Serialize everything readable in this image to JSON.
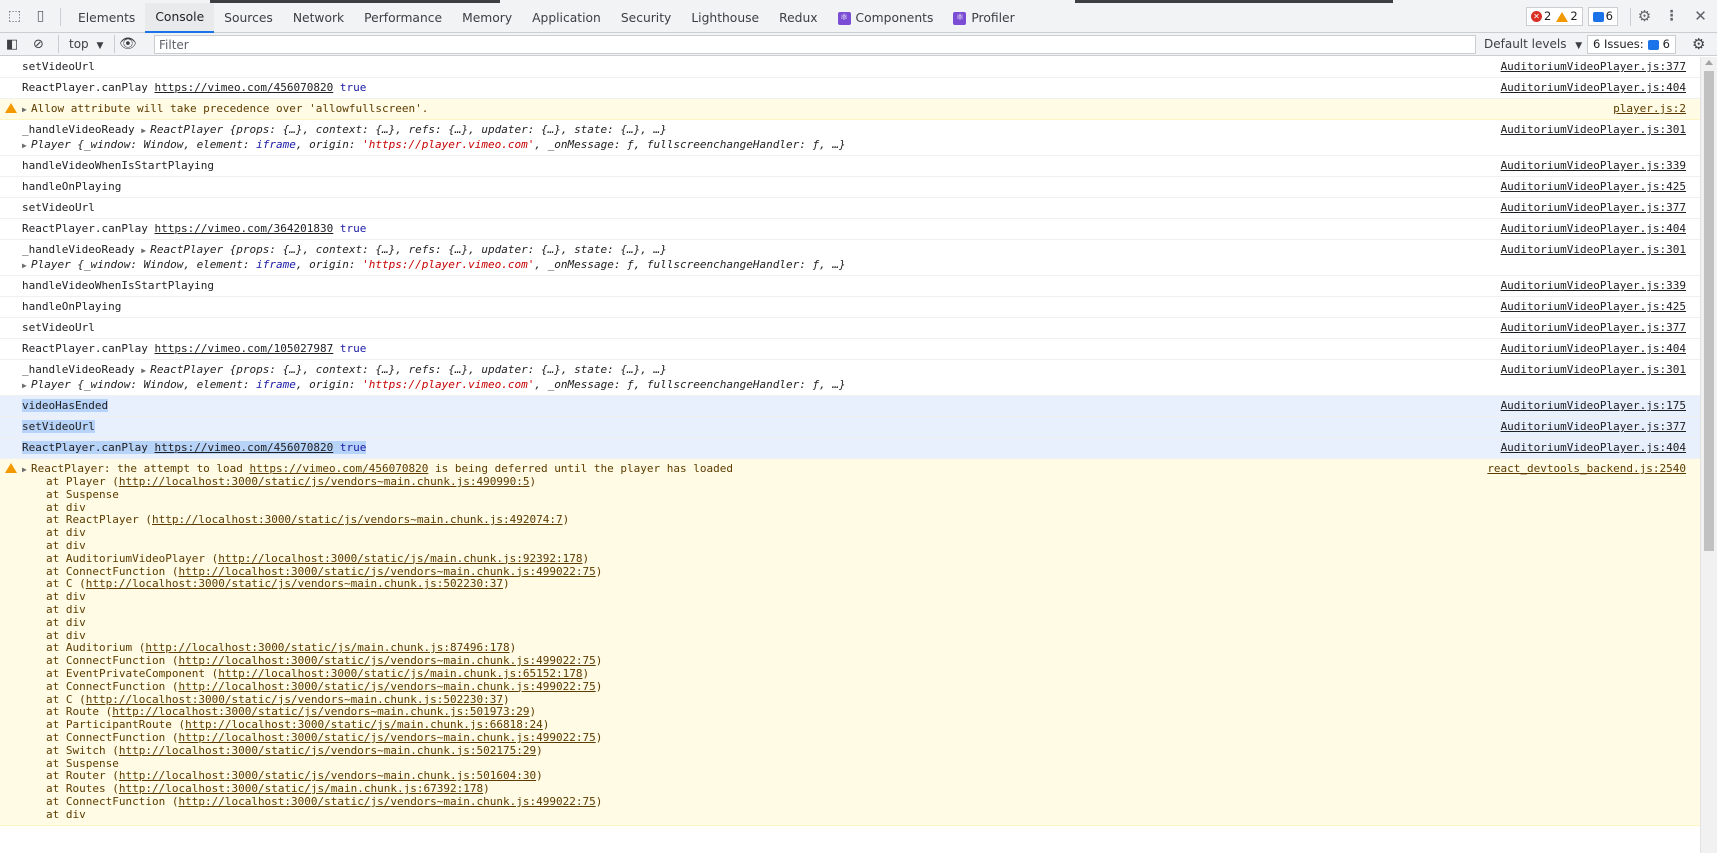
{
  "tabbar": {
    "tabs": [
      {
        "label": "Elements"
      },
      {
        "label": "Console"
      },
      {
        "label": "Sources"
      },
      {
        "label": "Network"
      },
      {
        "label": "Performance"
      },
      {
        "label": "Memory"
      },
      {
        "label": "Application"
      },
      {
        "label": "Security"
      },
      {
        "label": "Lighthouse"
      },
      {
        "label": "Redux"
      },
      {
        "label": "Components"
      },
      {
        "label": "Profiler"
      }
    ],
    "active_tab": "Console",
    "error_count": "2",
    "warning_count": "2",
    "message_count": "6"
  },
  "toolbar": {
    "context": "top",
    "context_arrow": "▼",
    "filter_placeholder": "Filter",
    "levels": "Default levels",
    "levels_arrow": "▼",
    "issues_label": "6 Issues:",
    "issues_count": "6"
  },
  "rows": [
    {
      "type": "single",
      "text": "setVideoUrl",
      "src": "AuditoriumVideoPlayer.js:377"
    },
    {
      "type": "canplay",
      "text": "ReactPlayer.canPlay",
      "url": "https://vimeo.com/456070820",
      "val": "true",
      "src": "AuditoriumVideoPlayer.js:404"
    },
    {
      "type": "warn1",
      "text": "Allow attribute will take precedence over 'allowfullscreen'.",
      "src": "player.js:2"
    },
    {
      "type": "ready",
      "text": "_handleVideoReady",
      "obj1": "ReactPlayer {props: {…}, context: {…}, refs: {…}, updater: {…}, state: {…}, …}",
      "obj2_pre": "Player {_window: Window, element: ",
      "obj2_kw": "iframe",
      "obj2_mid": ", origin: ",
      "obj2_str": "'https://player.vimeo.com'",
      "obj2_post": ", _onMessage: ƒ, fullscreenchangeHandler: ƒ, …}",
      "src": "AuditoriumVideoPlayer.js:301"
    },
    {
      "type": "single",
      "text": "handleVideoWhenIsStartPlaying",
      "src": "AuditoriumVideoPlayer.js:339"
    },
    {
      "type": "single",
      "text": "handleOnPlaying",
      "src": "AuditoriumVideoPlayer.js:425"
    },
    {
      "type": "single",
      "text": "setVideoUrl",
      "src": "AuditoriumVideoPlayer.js:377"
    },
    {
      "type": "canplay",
      "text": "ReactPlayer.canPlay",
      "url": "https://vimeo.com/364201830",
      "val": "true",
      "src": "AuditoriumVideoPlayer.js:404"
    },
    {
      "type": "ready",
      "text": "_handleVideoReady",
      "obj1": "ReactPlayer {props: {…}, context: {…}, refs: {…}, updater: {…}, state: {…}, …}",
      "obj2_pre": "Player {_window: Window, element: ",
      "obj2_kw": "iframe",
      "obj2_mid": ", origin: ",
      "obj2_str": "'https://player.vimeo.com'",
      "obj2_post": ", _onMessage: ƒ, fullscreenchangeHandler: ƒ, …}",
      "src": "AuditoriumVideoPlayer.js:301"
    },
    {
      "type": "single",
      "text": "handleVideoWhenIsStartPlaying",
      "src": "AuditoriumVideoPlayer.js:339"
    },
    {
      "type": "single",
      "text": "handleOnPlaying",
      "src": "AuditoriumVideoPlayer.js:425"
    },
    {
      "type": "single",
      "text": "setVideoUrl",
      "src": "AuditoriumVideoPlayer.js:377"
    },
    {
      "type": "canplay",
      "text": "ReactPlayer.canPlay",
      "url": "https://vimeo.com/105027987",
      "val": "true",
      "src": "AuditoriumVideoPlayer.js:404"
    },
    {
      "type": "ready",
      "text": "_handleVideoReady",
      "obj1": "ReactPlayer {props: {…}, context: {…}, refs: {…}, updater: {…}, state: {…}, …}",
      "obj2_pre": "Player {_window: Window, element: ",
      "obj2_kw": "iframe",
      "obj2_mid": ", origin: ",
      "obj2_str": "'https://player.vimeo.com'",
      "obj2_post": ", _onMessage: ƒ, fullscreenchangeHandler: ƒ, …}",
      "src": "AuditoriumVideoPlayer.js:301"
    },
    {
      "type": "sel",
      "text": "videoHasEnded",
      "src": "AuditoriumVideoPlayer.js:175"
    },
    {
      "type": "sel",
      "text": "setVideoUrl",
      "src": "AuditoriumVideoPlayer.js:377"
    },
    {
      "type": "selcanplay",
      "text": "ReactPlayer.canPlay",
      "url": "https://vimeo.com/456070820",
      "val": "true",
      "src": "AuditoriumVideoPlayer.js:404"
    }
  ],
  "deferred_warning": {
    "pre": "ReactPlayer: the attempt to load ",
    "url": "https://vimeo.com/456070820",
    "post": " is being deferred until the player has loaded",
    "src": "react_devtools_backend.js:2540",
    "stack": [
      {
        "name": "Player",
        "url": "http://localhost:3000/static/js/vendors~main.chunk.js:490990:5"
      },
      {
        "name": "Suspense"
      },
      {
        "name": "div"
      },
      {
        "name": "ReactPlayer",
        "url": "http://localhost:3000/static/js/vendors~main.chunk.js:492074:7"
      },
      {
        "name": "div"
      },
      {
        "name": "div"
      },
      {
        "name": "AuditoriumVideoPlayer",
        "url": "http://localhost:3000/static/js/main.chunk.js:92392:178"
      },
      {
        "name": "ConnectFunction",
        "url": "http://localhost:3000/static/js/vendors~main.chunk.js:499022:75"
      },
      {
        "name": "C",
        "url": "http://localhost:3000/static/js/vendors~main.chunk.js:502230:37"
      },
      {
        "name": "div"
      },
      {
        "name": "div"
      },
      {
        "name": "div"
      },
      {
        "name": "div"
      },
      {
        "name": "Auditorium",
        "url": "http://localhost:3000/static/js/main.chunk.js:87496:178"
      },
      {
        "name": "ConnectFunction",
        "url": "http://localhost:3000/static/js/vendors~main.chunk.js:499022:75"
      },
      {
        "name": "EventPrivateComponent",
        "url": "http://localhost:3000/static/js/main.chunk.js:65152:178"
      },
      {
        "name": "ConnectFunction",
        "url": "http://localhost:3000/static/js/vendors~main.chunk.js:499022:75"
      },
      {
        "name": "C",
        "url": "http://localhost:3000/static/js/vendors~main.chunk.js:502230:37"
      },
      {
        "name": "Route",
        "url": "http://localhost:3000/static/js/vendors~main.chunk.js:501973:29"
      },
      {
        "name": "ParticipantRoute",
        "url": "http://localhost:3000/static/js/main.chunk.js:66818:24"
      },
      {
        "name": "ConnectFunction",
        "url": "http://localhost:3000/static/js/vendors~main.chunk.js:499022:75"
      },
      {
        "name": "Switch",
        "url": "http://localhost:3000/static/js/vendors~main.chunk.js:502175:29"
      },
      {
        "name": "Suspense"
      },
      {
        "name": "Router",
        "url": "http://localhost:3000/static/js/vendors~main.chunk.js:501604:30"
      },
      {
        "name": "Routes",
        "url": "http://localhost:3000/static/js/main.chunk.js:67392:178"
      },
      {
        "name": "ConnectFunction",
        "url": "http://localhost:3000/static/js/vendors~main.chunk.js:499022:75"
      },
      {
        "name": "div"
      }
    ]
  },
  "colors": {
    "accent": "#1a73e8",
    "warning_bg": "#fffbe5",
    "selection_bg": "#e8f0fe",
    "error": "#d93025",
    "warning": "#f29900",
    "react_badge": "#7b4dd4"
  }
}
